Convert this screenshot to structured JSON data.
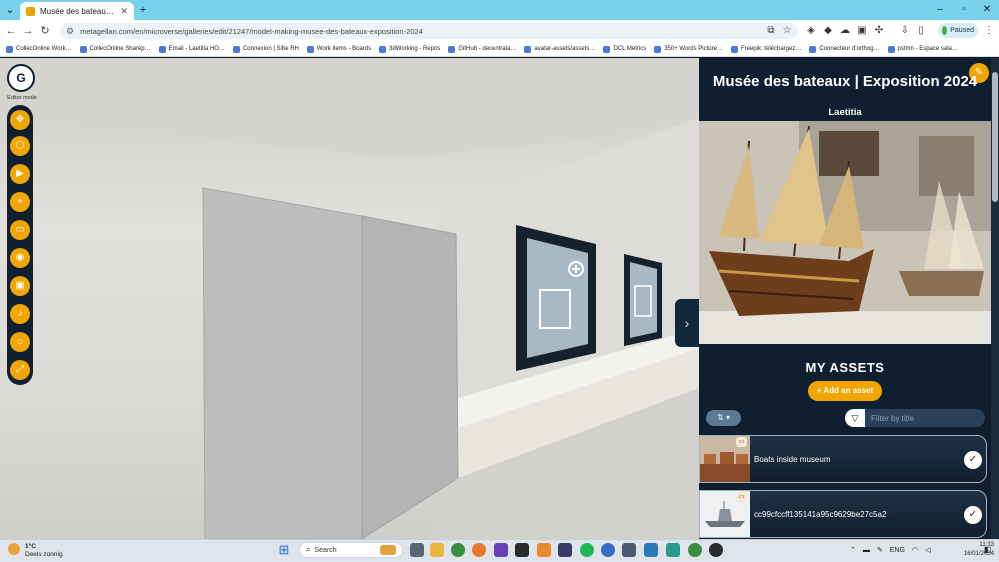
{
  "browser": {
    "tab_title": "Musée des bateaux | Exposition",
    "url": "metagellan.com/en/microverse/galleries/edit/21247/model-making-musee-des-bateaux-exposition-2024",
    "profile_label": "Paused",
    "bookmarks": [
      "CollecOnline Work…",
      "CollecOnline Sharep…",
      "Email - Laetitia HO…",
      "Connexion | Sibe RH",
      "Work items - Boards",
      "3dWorking - Repos",
      "GitHub - decentrala…",
      "avatar-assets/assets…",
      "DCL Metrics",
      "350+ Words Picture…",
      "Freepik: téléchargez…",
      "Connecteur d'orthog…",
      "pstmn - Espace sala…"
    ]
  },
  "editor": {
    "logo_label": "Editor mode"
  },
  "panel": {
    "title": "Musée des bateaux | Exposition 2024",
    "author": "Laetitia",
    "assets_heading": "MY ASSETS",
    "add_asset_label": "+ Add an asset",
    "filter_placeholder": "Filter by title",
    "assets": [
      {
        "name": "Boats inside museum"
      },
      {
        "name": "cc99cfccff135141a95c9629be27c5a2"
      }
    ]
  },
  "taskbar": {
    "weather_temp": "1°C",
    "weather_desc": "Deels zonnig",
    "search_label": "Search",
    "language": "ENG",
    "time": "11:33",
    "date": "16/01/2024"
  },
  "colors": {
    "accent": "#f0a500",
    "panel_bg": "#0f1f2f",
    "tabbar": "#78d2ec"
  }
}
